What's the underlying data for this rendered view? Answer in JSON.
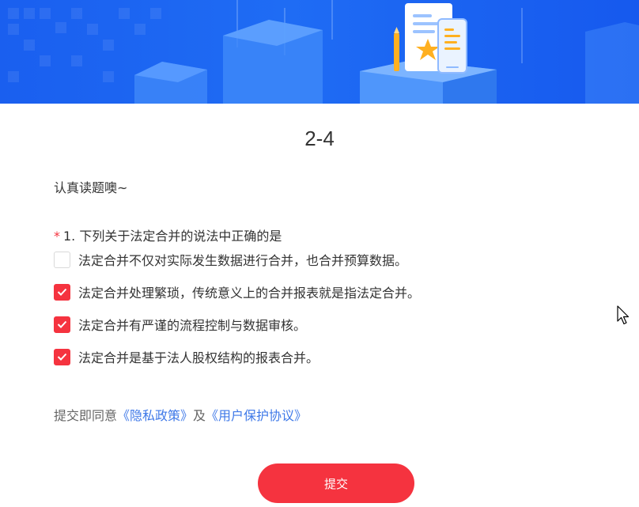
{
  "survey": {
    "title": "2-4",
    "intro": "认真读题噢~",
    "question": {
      "required_mark": "*",
      "text": "1. 下列关于法定合并的说法中正确的是",
      "options": [
        {
          "label": "法定合并不仅对实际发生数据进行合并，也合并预算数据。",
          "checked": false
        },
        {
          "label": "法定合并处理繁琐，传统意义上的合并报表就是指法定合并。",
          "checked": true
        },
        {
          "label": "法定合并有严谨的流程控制与数据审核。",
          "checked": true
        },
        {
          "label": "法定合并是基于法人股权结构的报表合并。",
          "checked": true
        }
      ]
    },
    "agreement": {
      "prefix": "提交即同意",
      "privacy_link": "《隐私政策》",
      "conjunction": "及",
      "user_link": "《用户保护协议》"
    },
    "submit_label": "提交"
  },
  "colors": {
    "accent": "#f5333f",
    "link": "#3f79e8",
    "banner": "#1a5fef"
  },
  "icons": {
    "banner": "document-phone-star-illustration",
    "checkbox": "check-icon",
    "pointer": "mouse-cursor-icon"
  }
}
